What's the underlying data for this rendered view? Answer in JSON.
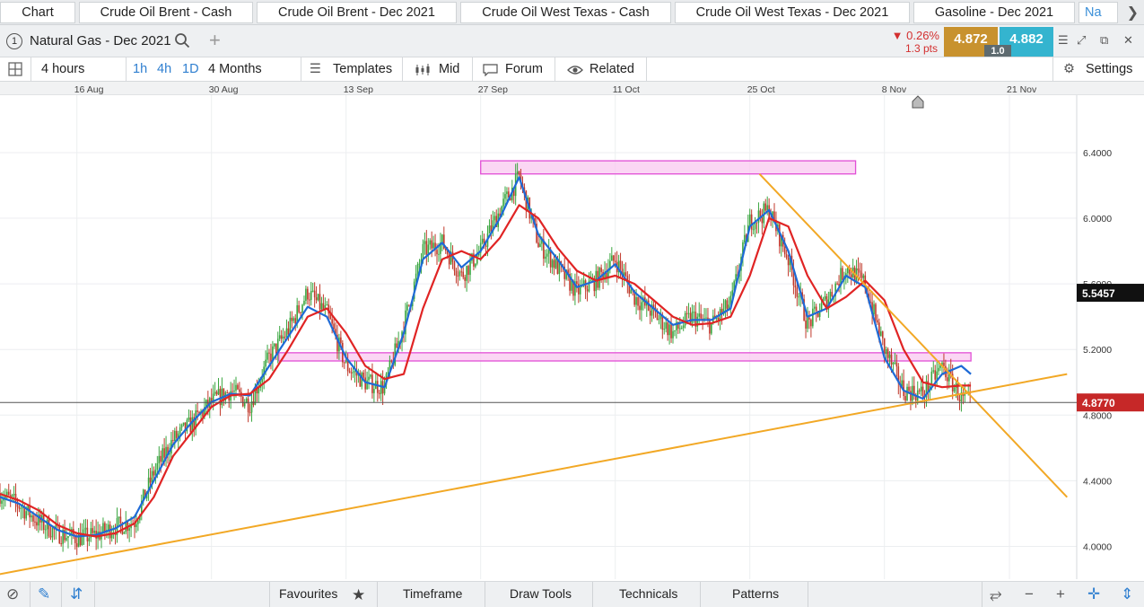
{
  "tabs": [
    {
      "label": "Chart"
    },
    {
      "label": "Crude Oil Brent - Cash"
    },
    {
      "label": "Crude Oil Brent - Dec 2021"
    },
    {
      "label": "Crude Oil West Texas - Cash"
    },
    {
      "label": "Crude Oil West Texas - Dec 2021"
    },
    {
      "label": "Gasoline - Dec 2021"
    },
    {
      "label": "Na"
    }
  ],
  "instrument": {
    "number": "1",
    "name": "Natural Gas - Dec 2021",
    "change_pct": "▼ 0.26%",
    "change_pts": "1.3 pts",
    "bid": "4.872",
    "ask": "4.882",
    "spread": "1.0"
  },
  "toolbar": {
    "interval": "4 hours",
    "quick_1h": "1h",
    "quick_4h": "4h",
    "quick_1d": "1D",
    "range": "4 Months",
    "templates": "Templates",
    "mid": "Mid",
    "forum": "Forum",
    "related": "Related",
    "settings": "Settings"
  },
  "bottom": {
    "favourites": "Favourites",
    "timeframe": "Timeframe",
    "draw_tools": "Draw Tools",
    "technicals": "Technicals",
    "patterns": "Patterns"
  },
  "colors": {
    "candle_up": "#3aa640",
    "candle_down": "#c0392b",
    "ma_fast": "#1e6ad6",
    "ma_slow": "#e02424",
    "trendline": "#f2a825",
    "zone_fill": "#f9c8f0",
    "zone_stroke": "#e24fd6",
    "price_label": "#c62828",
    "crosshair_label": "#111111"
  },
  "chart_data": {
    "type": "candlestick",
    "instrument": "Natural Gas - Dec 2021",
    "interval": "4 hours",
    "x_tick_labels": [
      "16 Aug",
      "30 Aug",
      "13 Sep",
      "27 Sep",
      "11 Oct",
      "25 Oct",
      "8 Nov",
      "21 Nov"
    ],
    "y_tick_labels": [
      "4.0000",
      "4.4000",
      "4.8000",
      "5.2000",
      "5.6000",
      "6.0000",
      "6.4000"
    ],
    "ylim": [
      3.8,
      6.75
    ],
    "xlim": [
      "2021-08-08",
      "2021-11-28"
    ],
    "grid": true,
    "current_price": 4.877,
    "current_price_label": "4.8770",
    "crosshair_price_label": "5.5457",
    "close_series": {
      "x": [
        "2021-08-08",
        "2021-08-10",
        "2021-08-12",
        "2021-08-14",
        "2021-08-16",
        "2021-08-18",
        "2021-08-20",
        "2021-08-22",
        "2021-08-24",
        "2021-08-26",
        "2021-08-28",
        "2021-08-30",
        "2021-09-01",
        "2021-09-03",
        "2021-09-05",
        "2021-09-07",
        "2021-09-09",
        "2021-09-11",
        "2021-09-13",
        "2021-09-15",
        "2021-09-17",
        "2021-09-19",
        "2021-09-21",
        "2021-09-23",
        "2021-09-25",
        "2021-09-27",
        "2021-09-29",
        "2021-10-01",
        "2021-10-03",
        "2021-10-05",
        "2021-10-07",
        "2021-10-09",
        "2021-10-11",
        "2021-10-13",
        "2021-10-15",
        "2021-10-17",
        "2021-10-19",
        "2021-10-21",
        "2021-10-23",
        "2021-10-25",
        "2021-10-27",
        "2021-10-29",
        "2021-10-31",
        "2021-11-02",
        "2021-11-04",
        "2021-11-06",
        "2021-11-08",
        "2021-11-10",
        "2021-11-12",
        "2021-11-14",
        "2021-11-16",
        "2021-11-17"
      ],
      "y": [
        4.32,
        4.25,
        4.15,
        4.08,
        4.05,
        4.07,
        4.12,
        4.15,
        4.45,
        4.65,
        4.75,
        4.88,
        4.95,
        4.87,
        5.15,
        5.32,
        5.55,
        5.42,
        5.1,
        5.0,
        4.97,
        5.35,
        5.8,
        5.85,
        5.65,
        5.8,
        6.05,
        6.25,
        5.85,
        5.7,
        5.55,
        5.62,
        5.75,
        5.52,
        5.42,
        5.3,
        5.4,
        5.35,
        5.48,
        5.98,
        6.05,
        5.75,
        5.35,
        5.5,
        5.7,
        5.6,
        5.2,
        4.95,
        4.93,
        5.1,
        4.9,
        4.877
      ]
    },
    "moving_averages": [
      {
        "color": "blue",
        "y": [
          4.3,
          4.26,
          4.18,
          4.1,
          4.06,
          4.07,
          4.11,
          4.18,
          4.4,
          4.62,
          4.76,
          4.88,
          4.93,
          4.92,
          5.1,
          5.28,
          5.46,
          5.4,
          5.15,
          5.0,
          4.97,
          5.3,
          5.75,
          5.85,
          5.7,
          5.8,
          6.0,
          6.25,
          5.9,
          5.75,
          5.58,
          5.62,
          5.72,
          5.55,
          5.45,
          5.35,
          5.38,
          5.38,
          5.45,
          5.95,
          6.05,
          5.8,
          5.4,
          5.45,
          5.65,
          5.58,
          5.15,
          4.95,
          4.9,
          5.05,
          5.1,
          5.05
        ]
      },
      {
        "color": "red",
        "y": [
          4.32,
          4.28,
          4.22,
          4.13,
          4.08,
          4.06,
          4.08,
          4.14,
          4.3,
          4.55,
          4.7,
          4.85,
          4.92,
          4.93,
          5.02,
          5.2,
          5.4,
          5.45,
          5.3,
          5.1,
          5.02,
          5.05,
          5.45,
          5.75,
          5.8,
          5.75,
          5.88,
          6.08,
          6.0,
          5.82,
          5.68,
          5.62,
          5.65,
          5.6,
          5.5,
          5.4,
          5.35,
          5.36,
          5.4,
          5.65,
          6.0,
          5.95,
          5.65,
          5.45,
          5.52,
          5.62,
          5.5,
          5.2,
          5.0,
          4.97,
          4.98,
          4.98
        ]
      }
    ],
    "trendlines": [
      {
        "kind": "rising support",
        "from": [
          "2021-08-07",
          3.82
        ],
        "to": [
          "2021-11-27",
          5.05
        ]
      },
      {
        "kind": "falling resistance",
        "from": [
          "2021-10-26",
          6.27
        ],
        "to": [
          "2021-11-27",
          4.3
        ]
      }
    ],
    "zones": [
      {
        "from_date": "2021-09-27",
        "to_date": "2021-11-05",
        "y_low": 6.27,
        "y_high": 6.35
      },
      {
        "from_date": "2021-09-06",
        "to_date": "2021-11-17",
        "y_low": 5.13,
        "y_high": 5.18
      }
    ]
  }
}
